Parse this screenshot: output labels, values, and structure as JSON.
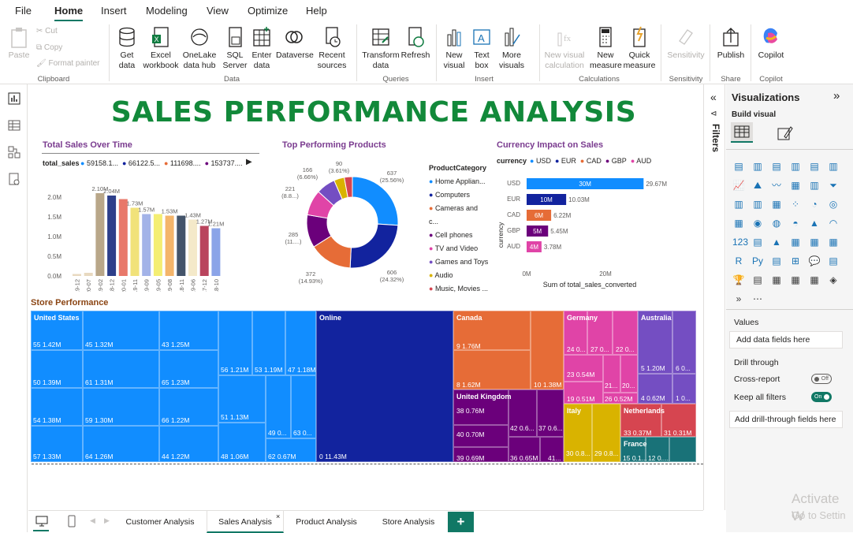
{
  "menu": [
    "File",
    "Home",
    "Insert",
    "Modeling",
    "View",
    "Optimize",
    "Help"
  ],
  "ribbon": {
    "clipboard": {
      "paste": "Paste",
      "cut": "Cut",
      "copy": "Copy",
      "format_painter": "Format painter",
      "label": "Clipboard"
    },
    "data": {
      "get_data": "Get data",
      "excel": "Excel workbook",
      "onelake": "OneLake data hub",
      "sql": "SQL Server",
      "enter": "Enter data",
      "dataverse": "Dataverse",
      "recent": "Recent sources",
      "label": "Data"
    },
    "queries": {
      "transform": "Transform data",
      "refresh": "Refresh",
      "label": "Queries"
    },
    "insert": {
      "new_visual": "New visual",
      "text_box": "Text box",
      "more_visuals": "More visuals",
      "label": "Insert"
    },
    "calculations": {
      "new_visual_calc": "New visual calculation",
      "new_measure": "New measure",
      "quick_measure": "Quick measure",
      "label": "Calculations"
    },
    "sensitivity": {
      "sensitivity": "Sensitivity",
      "label": "Sensitivity"
    },
    "share": {
      "publish": "Publish",
      "label": "Share"
    },
    "copilot": {
      "copilot": "Copilot",
      "label": "Copilot"
    }
  },
  "report": {
    "title": "SALES PERFORMANCE ANALYSIS",
    "colors": {
      "title": "#12893a",
      "accent_purple": "#7a3b8f",
      "accent_brown": "#8b4513",
      "teal": "#117865"
    }
  },
  "sales_over_time": {
    "title": "Total Sales Over Time",
    "legend_field": "total_sales",
    "legend_items": [
      "59158.1...",
      "66122.5...",
      "111698....",
      "153737...."
    ],
    "legend_colors": [
      "#118dff",
      "#12239e",
      "#e66c37",
      "#6b007b"
    ],
    "chart_data": {
      "type": "bar",
      "categories": [
        "2019-12",
        "2020-07",
        "2019-02",
        "2018-12",
        "2020-01",
        "2019-11",
        "2019-09",
        "2019-05",
        "2019-08",
        "2018-11",
        "2019-06",
        "2017-12",
        "2018-10"
      ],
      "values": [
        0.05,
        0.08,
        2.1,
        2.04,
        1.95,
        1.73,
        1.57,
        1.57,
        1.53,
        1.53,
        1.43,
        1.27,
        1.21
      ],
      "data_labels": [
        "",
        "",
        "2.10M",
        "2.04M",
        "",
        "1.73M",
        "1.57M",
        "",
        "1.53M",
        "",
        "1.43M",
        "1.27M",
        "1.21M"
      ],
      "yticks": [
        "0.0M",
        "0.5M",
        "1.0M",
        "1.5M",
        "2.0M"
      ],
      "ylim": [
        0,
        2.2
      ],
      "colors": [
        "#e8d9c0",
        "#e8d9c0",
        "#b9a789",
        "#2d3f8a",
        "#e8786a",
        "#f1e27a",
        "#a3b3e8",
        "#f4ee73",
        "#f4b56a",
        "#44546a",
        "#f4e9c9",
        "#b9445d",
        "#8ba4e8"
      ]
    }
  },
  "top_products": {
    "title": "Top Performing Products",
    "legend_title": "ProductCategory",
    "legend": [
      {
        "name": "Home Applian...",
        "color": "#118dff"
      },
      {
        "name": "Computers",
        "color": "#12239e"
      },
      {
        "name": "Cameras and c...",
        "color": "#e66c37"
      },
      {
        "name": "Cell phones",
        "color": "#6b007b"
      },
      {
        "name": "TV and Video",
        "color": "#e044a7"
      },
      {
        "name": "Games and Toys",
        "color": "#744ec2"
      },
      {
        "name": "Audio",
        "color": "#d9b300"
      },
      {
        "name": "Music, Movies ...",
        "color": "#d64550"
      }
    ],
    "chart_data": {
      "type": "pie",
      "labels": [
        "Home Applian...",
        "Computers",
        "Cameras and c...",
        "Cell phones",
        "TV and Video",
        "Games and Toys",
        "Audio",
        "Music, Movies ..."
      ],
      "values": [
        637,
        606,
        372,
        285,
        221,
        166,
        90,
        70
      ],
      "data_labels": [
        "637 (25.56%)",
        "606 (24.32%)",
        "372 (14.93%)",
        "285 (11....)",
        "221 (8.8...)",
        "166 (6.66%)",
        "90 (3.61%)",
        ""
      ]
    }
  },
  "currency": {
    "title": "Currency Impact on Sales",
    "legend_field": "currency",
    "legend": [
      {
        "name": "USD",
        "color": "#118dff"
      },
      {
        "name": "EUR",
        "color": "#12239e"
      },
      {
        "name": "CAD",
        "color": "#e66c37"
      },
      {
        "name": "GBP",
        "color": "#6b007b"
      },
      {
        "name": "AUD",
        "color": "#e044a7"
      }
    ],
    "ylabel": "currency",
    "xlabel": "Sum of total_sales_converted",
    "xticks": [
      "0M",
      "20M"
    ],
    "chart_data": {
      "type": "bar",
      "categories": [
        "USD",
        "EUR",
        "CAD",
        "GBP",
        "AUD"
      ],
      "values": [
        29.67,
        10.03,
        6.22,
        5.45,
        3.78
      ],
      "inner_labels": [
        "30M",
        "10M",
        "6M",
        "5M",
        "4M"
      ],
      "end_labels": [
        "29.67M",
        "10.03M",
        "6.22M",
        "5.45M",
        "3.78M"
      ],
      "xlim": [
        0,
        35
      ]
    }
  },
  "store_performance": {
    "title": "Store Performance",
    "chart_data": {
      "type": "treemap",
      "groups": [
        {
          "name": "United States",
          "values": [
            "55 1.42M",
            "45 1.32M",
            "43 1.25M",
            "56 1.21M",
            "53 1.19M",
            "47 1.18M",
            "50 1.39M",
            "61 1.31M",
            "65 1.23M",
            "51 1.13M",
            "54 1.38M",
            "59 1.30M",
            "66 1.22M",
            "49 0...",
            "63 0...",
            "57 1.33M",
            "64 1.26M",
            "44 1.22M",
            "48 1.06M",
            "62 0.67M"
          ]
        },
        {
          "name": "Online",
          "values": [
            "0 11.43M"
          ]
        },
        {
          "name": "Canada",
          "values": [
            "9 1.76M",
            "8 1.62M",
            "10 1.38M"
          ]
        },
        {
          "name": "United Kingdom",
          "values": [
            "38 0.76M",
            "40 0.70M",
            "42 0.6...",
            "37 0.6...",
            "39 0.69M",
            "36 0.65M",
            "41..."
          ]
        },
        {
          "name": "Germany",
          "values": [
            "24 0...",
            "27 0...",
            "22 0...",
            "23 0.54M",
            "21...",
            "20...",
            "19 0.51M",
            "26 0.52M"
          ]
        },
        {
          "name": "Australia",
          "values": [
            "5 1.20M",
            "6 0...",
            "4 0.62M",
            "1 0..."
          ]
        },
        {
          "name": "Italy",
          "values": [
            "30 0.8...",
            "29 0.8..."
          ]
        },
        {
          "name": "Netherlands",
          "values": [
            "33 0.37M",
            "31 0.31M"
          ]
        },
        {
          "name": "France",
          "values": [
            "15 0.1...",
            "12 0...."
          ]
        }
      ]
    }
  },
  "filters": {
    "label": "Filters"
  },
  "viz_pane": {
    "title": "Visualizations",
    "build_visual": "Build visual",
    "values_label": "Values",
    "add_data_fields": "Add data fields here",
    "drill_through": "Drill through",
    "cross_report": "Cross-report",
    "cross_report_state": "Off",
    "keep_all_filters": "Keep all filters",
    "keep_all_filters_state": "On",
    "add_drill_fields": "Add drill-through fields here"
  },
  "pages": [
    "Customer Analysis",
    "Sales Analysis",
    "Product Analysis",
    "Store Analysis"
  ],
  "active_page": "Sales Analysis",
  "watermark": {
    "line1": "Activate W",
    "line2": "Go to Settin"
  }
}
